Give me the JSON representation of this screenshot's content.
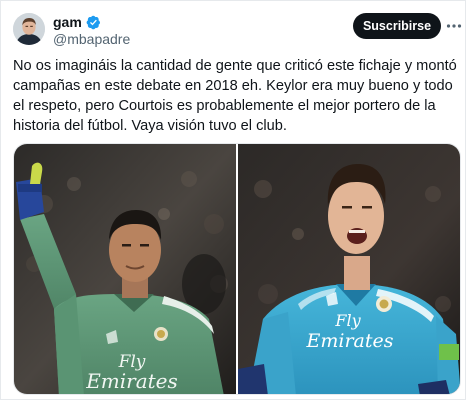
{
  "author": {
    "display_name": "gam",
    "handle": "@mbapadre",
    "verified_icon": "verified-badge-icon",
    "avatar_icon": "avatar-portrait"
  },
  "actions": {
    "subscribe_label": "Suscribirse",
    "more_icon": "more-options-icon"
  },
  "tweet": {
    "text": "No os imagináis la cantidad de gente que criticó este fichaje y montó campañas en este debate en 2018 eh. Keylor era muy bueno y todo el respeto, pero Courtois es probablemente el mejor portero de la historia del fútbol. Vaya visión tuvo el club."
  },
  "media": {
    "left_photo": {
      "kit_text_line1": "Fly",
      "kit_text_line2": "Emirates",
      "kit_color": "#5f9a78"
    },
    "right_photo": {
      "kit_text_line1": "Fly",
      "kit_text_line2": "Emirates",
      "kit_color": "#35a9cf"
    }
  },
  "colors": {
    "accent": "#1d9bf0",
    "text": "#0f1419",
    "secondary_text": "#536471",
    "button_bg": "#0f1419"
  }
}
